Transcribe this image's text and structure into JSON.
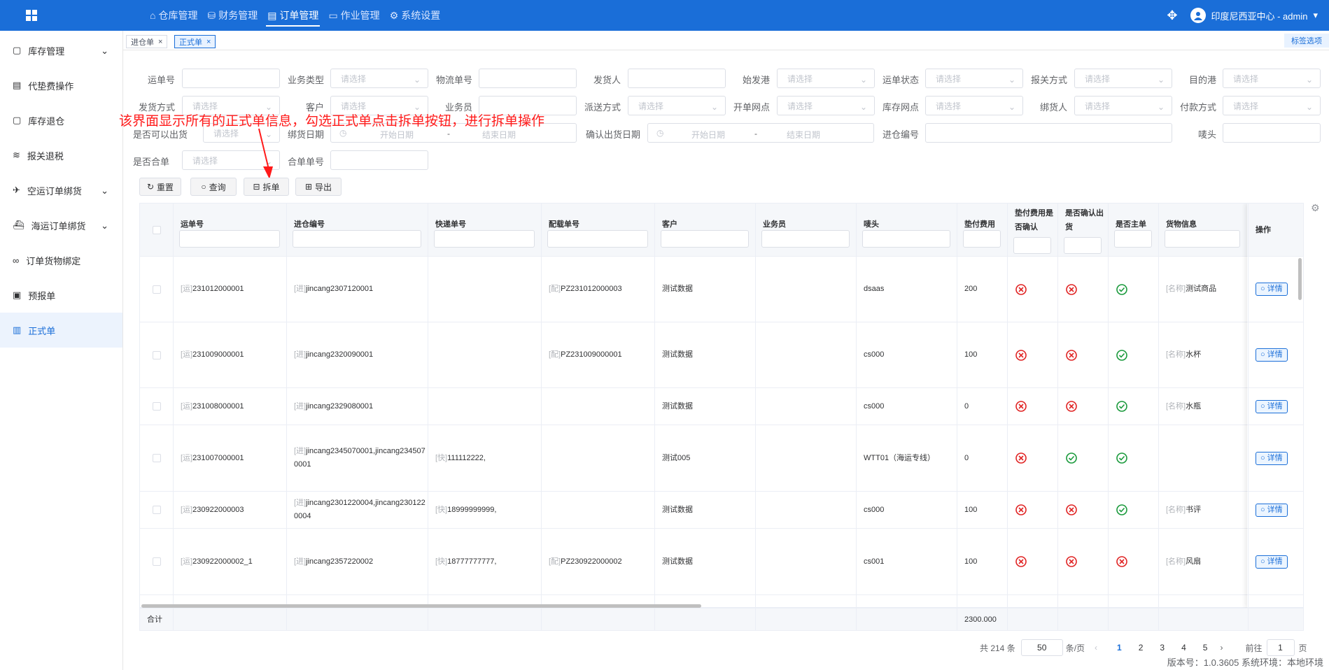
{
  "topbar": {
    "nav": [
      {
        "label": "仓库管理",
        "icon": "home-icon",
        "active": false
      },
      {
        "label": "财务管理",
        "icon": "database-icon",
        "active": false
      },
      {
        "label": "订单管理",
        "icon": "document-icon",
        "active": true
      },
      {
        "label": "作业管理",
        "icon": "folder-icon",
        "active": false
      },
      {
        "label": "系统设置",
        "icon": "gear-icon",
        "active": false
      }
    ],
    "user": "印度尼西亚中心 - admin"
  },
  "sidebar": {
    "items": [
      {
        "label": "库存管理",
        "icon": "box-icon",
        "arrow": true
      },
      {
        "label": "代垫费操作",
        "icon": "receipt-icon",
        "arrow": false
      },
      {
        "label": "库存退仓",
        "icon": "box-icon",
        "arrow": false
      },
      {
        "label": "报关退税",
        "icon": "stack-icon",
        "arrow": false
      },
      {
        "label": "空运订单绑货",
        "icon": "plane-icon",
        "arrow": true
      },
      {
        "label": "海运订单绑货",
        "icon": "ship-icon",
        "arrow": true
      },
      {
        "label": "订单货物绑定",
        "icon": "link-icon",
        "arrow": false
      },
      {
        "label": "预报单",
        "icon": "form-icon",
        "arrow": false
      },
      {
        "label": "正式单",
        "icon": "doc-icon",
        "arrow": false,
        "active": true
      }
    ]
  },
  "tabs": [
    {
      "label": "进仓单",
      "active": false
    },
    {
      "label": "正式单",
      "active": true
    }
  ],
  "tab_options": "标签选项",
  "filters": {
    "row1": [
      "运单号",
      "业务类型",
      "物流单号",
      "发货人",
      "始发港",
      "运单状态",
      "报关方式",
      "目的港"
    ],
    "row2": [
      "发货方式",
      "客户",
      "业务员",
      "派送方式",
      "开单网点",
      "库存网点",
      "绑货人",
      "付款方式"
    ],
    "row3": [
      "是否可以出货",
      "绑货日期",
      "确认出货日期",
      "进仓编号",
      "唛头"
    ],
    "row4": [
      "是否合单",
      "合单单号"
    ],
    "placeholder": "请选择",
    "start_date": "开始日期",
    "end_date": "结束日期",
    "dash": "-"
  },
  "annotation": "该界面显示所有的正式单信息，勾选正式单点击拆单按钮，进行拆单操作",
  "buttons": {
    "reset": "重置",
    "query": "查询",
    "split": "拆单",
    "export": "导出"
  },
  "columns": [
    "运单号",
    "进仓编号",
    "快递单号",
    "配载单号",
    "客户",
    "业务员",
    "唛头",
    "垫付费用",
    "垫付费用是否确认",
    "是否确认出货",
    "是否主单",
    "货物信息",
    "操作"
  ],
  "prefixes": {
    "yun": "[运]",
    "jin": "[进]",
    "kuai": "[快]",
    "pei": "[配]",
    "name": "[名称]"
  },
  "rows": [
    {
      "yun": "231012000001",
      "jin": "jincang2307120001",
      "kuai": "",
      "pei": "PZ231012000003",
      "customer": "测试数据",
      "mark": "dsaas",
      "fee": "200",
      "fee_ok": false,
      "ship_ok": false,
      "main": true,
      "goods": "测试商品"
    },
    {
      "yun": "231009000001",
      "jin": "jincang2320090001",
      "kuai": "",
      "pei": "PZ231009000001",
      "customer": "测试数据",
      "mark": "cs000",
      "fee": "100",
      "fee_ok": false,
      "ship_ok": false,
      "main": true,
      "goods": "水杯"
    },
    {
      "yun": "231008000001",
      "jin": "jincang2329080001",
      "kuai": "",
      "pei": "",
      "customer": "测试数据",
      "mark": "cs000",
      "fee": "0",
      "fee_ok": false,
      "ship_ok": false,
      "main": true,
      "goods": "水瓶"
    },
    {
      "yun": "231007000001",
      "jin": "jincang2345070001,jincang2345070001",
      "kuai": "111112222,",
      "pei": "",
      "customer": "测试005",
      "mark": "WTT01（海运专线）",
      "fee": "0",
      "fee_ok": false,
      "ship_ok": true,
      "main": true,
      "goods": ""
    },
    {
      "yun": "230922000003",
      "jin": "jincang2301220004,jincang2301220004",
      "kuai": "18999999999,",
      "pei": "",
      "customer": "测试数据",
      "mark": "cs000",
      "fee": "100",
      "fee_ok": false,
      "ship_ok": false,
      "main": true,
      "goods": "书评"
    },
    {
      "yun": "230922000002_1",
      "jin": "jincang2357220002",
      "kuai": "18777777777,",
      "pei": "PZ230922000002",
      "customer": "测试数据",
      "mark": "cs001",
      "fee": "100",
      "fee_ok": false,
      "ship_ok": false,
      "main": false,
      "goods": "风扇"
    }
  ],
  "detail_label": "详情",
  "summary": {
    "label": "合计",
    "fee_total": "2300.000"
  },
  "pagination": {
    "total": "共 214 条",
    "page_size": "50",
    "per_page": "条/页",
    "pages": [
      "1",
      "2",
      "3",
      "4",
      "5"
    ],
    "goto": "前往",
    "goto_value": "1",
    "page_unit": "页"
  },
  "version": "版本号：1.0.3605 系统环境：本地环境",
  "colors": {
    "brand": "#1a6ed8",
    "ok": "#1a9a3c",
    "no": "#e02424",
    "annotation": "#ff1a1a"
  }
}
